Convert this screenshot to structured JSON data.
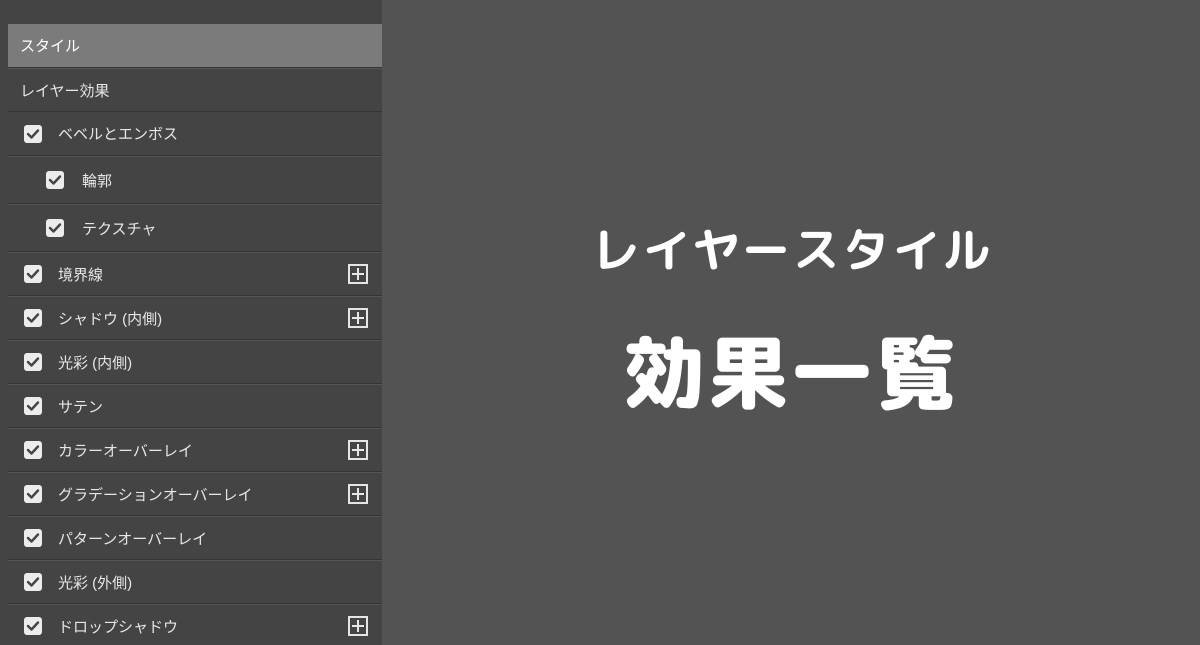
{
  "panel": {
    "header": "スタイル",
    "layer_effects": "レイヤー効果",
    "items": [
      {
        "label": "ベベルとエンボス",
        "checked": true,
        "plus": false,
        "sub": false
      },
      {
        "label": "輪郭",
        "checked": true,
        "plus": false,
        "sub": true
      },
      {
        "label": "テクスチャ",
        "checked": true,
        "plus": false,
        "sub": true
      },
      {
        "label": "境界線",
        "checked": true,
        "plus": true,
        "sub": false
      },
      {
        "label": "シャドウ (内側)",
        "checked": true,
        "plus": true,
        "sub": false
      },
      {
        "label": "光彩 (内側)",
        "checked": true,
        "plus": false,
        "sub": false
      },
      {
        "label": "サテン",
        "checked": true,
        "plus": false,
        "sub": false
      },
      {
        "label": "カラーオーバーレイ",
        "checked": true,
        "plus": true,
        "sub": false
      },
      {
        "label": "グラデーションオーバーレイ",
        "checked": true,
        "plus": true,
        "sub": false
      },
      {
        "label": "パターンオーバーレイ",
        "checked": true,
        "plus": false,
        "sub": false
      },
      {
        "label": "光彩 (外側)",
        "checked": true,
        "plus": false,
        "sub": false
      },
      {
        "label": "ドロップシャドウ",
        "checked": true,
        "plus": true,
        "sub": false
      }
    ]
  },
  "title": {
    "line1": "レイヤースタイル",
    "line2": "効果一覧"
  }
}
